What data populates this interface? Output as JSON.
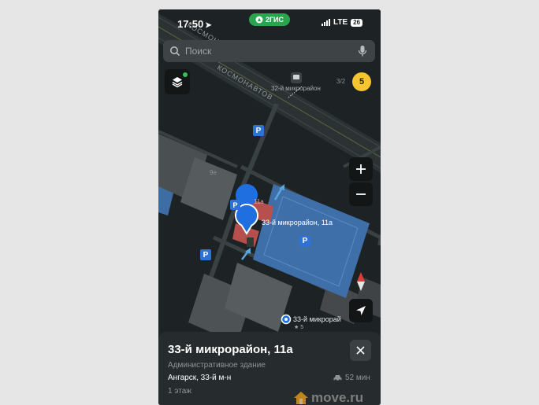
{
  "status": {
    "time": "17:50",
    "app_name": "2ГИС",
    "network": "LTE",
    "battery": "26"
  },
  "search": {
    "placeholder": "Поиск"
  },
  "map": {
    "road_label": "КОСМОНАВТОВ",
    "stop_label": "32-й микрорайон",
    "house_3_2": "3/2",
    "house_9e": "9е",
    "house_11a": "11а",
    "selected_label": "33-й микрорайон, 11а",
    "poi_label": "33-й микрорай",
    "poi_rating": "★ 5",
    "parking_glyph": "P",
    "traffic_score": "5"
  },
  "card": {
    "title": "33-й микрорайон, 11а",
    "subtitle": "Административное здание",
    "address": "Ангарск, 33-й м-н",
    "travel_time": "52 мин",
    "floor": "1 этаж"
  },
  "watermark": "move.ru",
  "colors": {
    "map_bg": "#1d2224",
    "selected_building": "#3f6fa8",
    "pin": "#1f6fe0",
    "accent_green": "#2aa44f",
    "traffic_yellow": "#f7c531"
  }
}
